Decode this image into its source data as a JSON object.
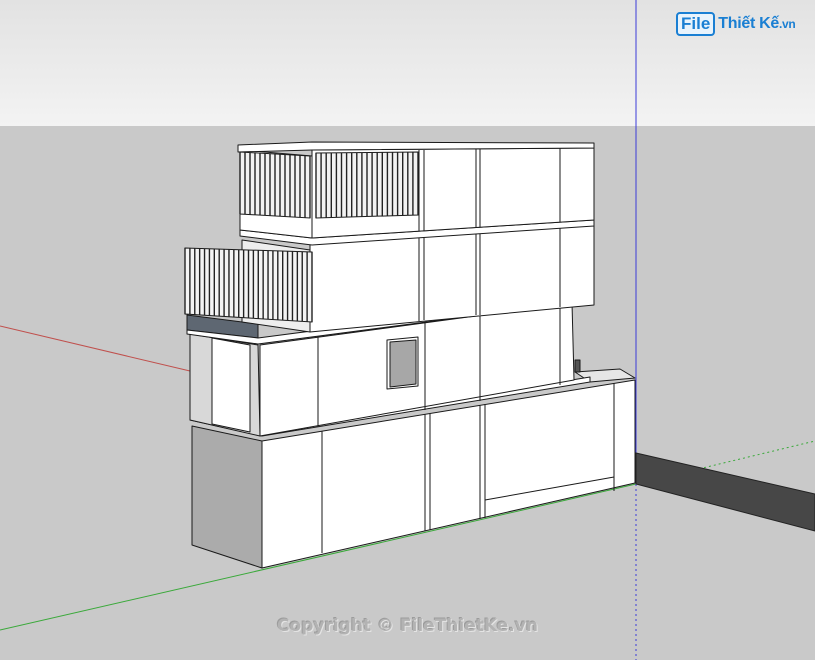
{
  "logo": {
    "file": "File",
    "rest": "Thiết Kế",
    "domain": ".vn"
  },
  "watermark": "Copyright © FileThietKe.vn",
  "colors": {
    "sky": "#ebebeb",
    "ground": "#c9c9c9",
    "wall": "#ffffff",
    "wall_shade": "#a9a9a9",
    "slab_dark": "#5e6772",
    "shadow": "#474747",
    "red_axis": "#c0504d",
    "green_axis": "#3aa93a",
    "blue_axis": "#3b3bd8"
  }
}
